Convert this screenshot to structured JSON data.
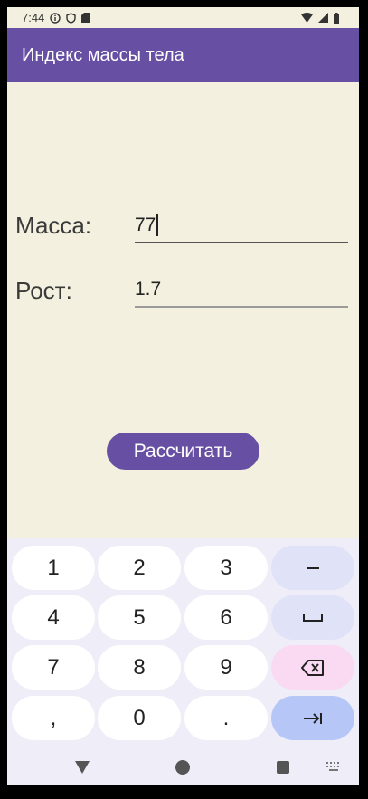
{
  "status_bar": {
    "time": "7:44"
  },
  "app_bar": {
    "title": "Индекс массы тела"
  },
  "form": {
    "mass_label": "Масса:",
    "mass_value": "77",
    "height_label": "Рост:",
    "height_value": "1.7",
    "calculate_label": "Рассчитать"
  },
  "keyboard": {
    "rows": [
      [
        "1",
        "2",
        "3",
        "–"
      ],
      [
        "4",
        "5",
        "6",
        "␣"
      ],
      [
        "7",
        "8",
        "9",
        "⌫"
      ],
      [
        ",",
        "0",
        ".",
        "⇥"
      ]
    ]
  },
  "colors": {
    "primary": "#6750A4",
    "background": "#F3F0DF",
    "keyboard_bg": "#EFEDF7"
  }
}
